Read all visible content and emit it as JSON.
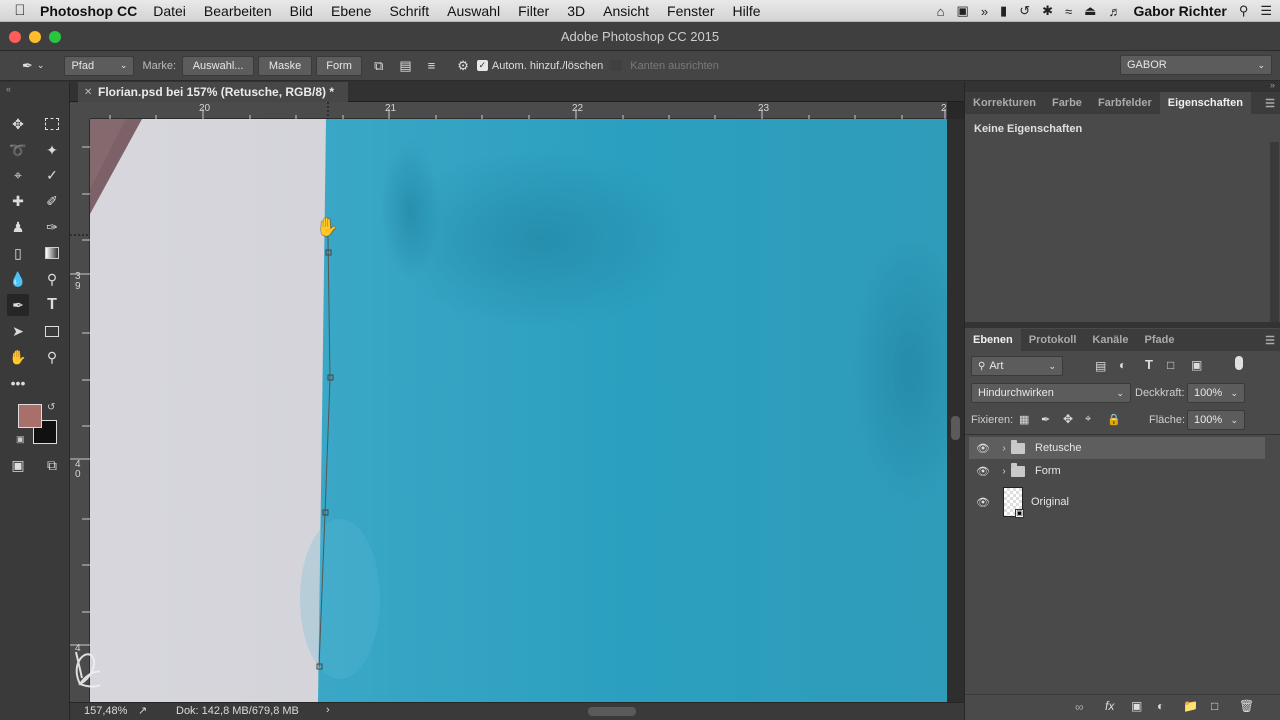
{
  "menubar": {
    "app_name": "Photoshop CC",
    "items": [
      "Datei",
      "Bearbeiten",
      "Bild",
      "Ebene",
      "Schrift",
      "Auswahl",
      "Filter",
      "3D",
      "Ansicht",
      "Fenster",
      "Hilfe"
    ],
    "user": "Gabor Richter"
  },
  "window": {
    "title": "Adobe Photoshop CC 2015"
  },
  "options": {
    "mode": "Pfad",
    "marke_label": "Marke:",
    "auswahl_button": "Auswahl...",
    "maske_button": "Maske",
    "form_button": "Form",
    "auto_add_checked": true,
    "auto_add_label": "Autom. hinzuf./löschen",
    "align_edges_label": "Kanten ausrichten",
    "workspace": "GABOR"
  },
  "document": {
    "tab_title": "Florian.psd bei 157% (Retusche, RGB/8) *",
    "ruler_h_labels": [
      "20",
      "21",
      "22",
      "23",
      "2"
    ],
    "ruler_v_labels": [
      "3",
      "9",
      "4",
      "0",
      "4"
    ],
    "zoom": "157,48%",
    "doc_info": "Dok: 142,8 MB/679,8 MB"
  },
  "colors": {
    "foreground": "#a8706b",
    "background": "#111111",
    "canvas_left": "#d4d4da",
    "canvas_right": "#2ea3c2"
  },
  "properties_panel": {
    "tabs": [
      "Korrekturen",
      "Farbe",
      "Farbfelder",
      "Eigenschaften"
    ],
    "active_tab": "Eigenschaften",
    "empty_text": "Keine Eigenschaften"
  },
  "layers_panel": {
    "tabs": [
      "Ebenen",
      "Protokoll",
      "Kanäle",
      "Pfade"
    ],
    "filter": "Art",
    "blend_mode": "Hindurchwirken",
    "opacity_label": "Deckkraft:",
    "opacity": "100%",
    "lock_label": "Fixieren:",
    "fill_label": "Fläche:",
    "fill": "100%",
    "layers": [
      {
        "name": "Retusche",
        "type": "group",
        "selected": true
      },
      {
        "name": "Form",
        "type": "group",
        "selected": false
      },
      {
        "name": "Original",
        "type": "pixel",
        "selected": false
      }
    ],
    "footer_icons": [
      "link-icon",
      "fx-icon",
      "mask-icon",
      "adjustment-icon",
      "new-group-icon",
      "new-layer-icon",
      "trash-icon"
    ]
  }
}
